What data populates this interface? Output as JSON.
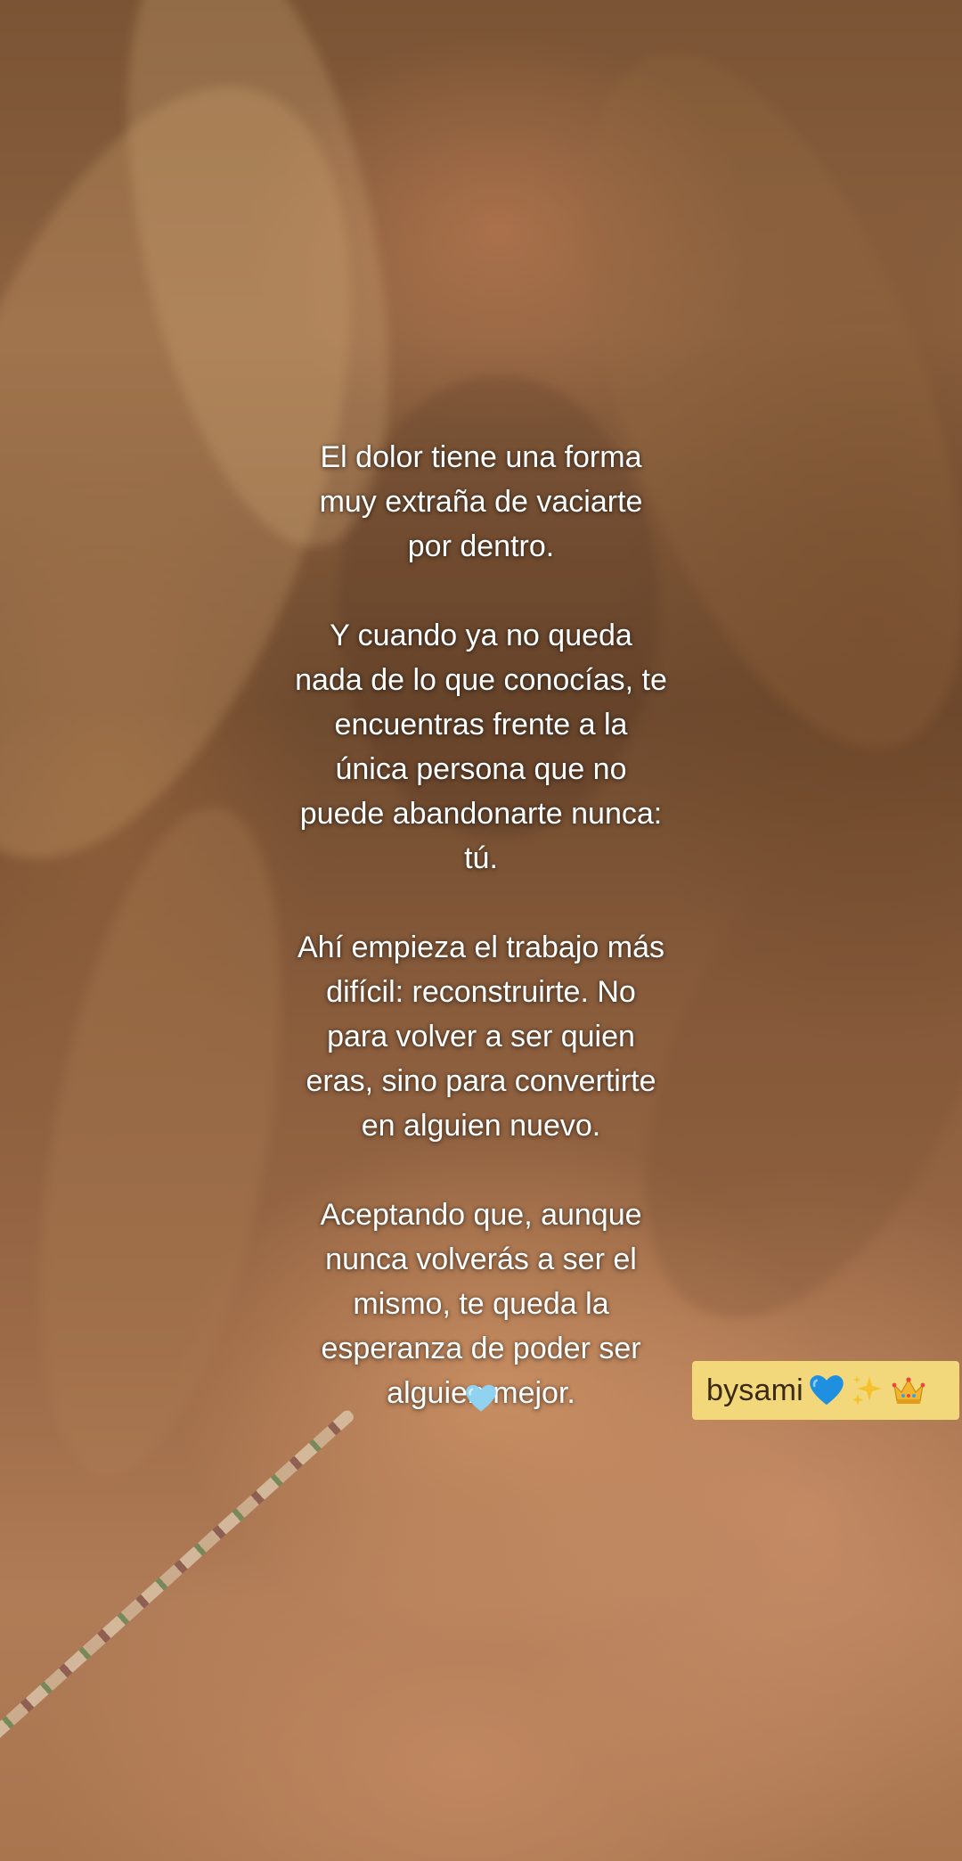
{
  "caption": {
    "text": "El dolor tiene una forma\nmuy extraña de vaciarte\npor dentro.\n\nY cuando ya no queda\nnada de lo que conocías, te\nencuentras frente a la\núnica persona que no\npuede abandonarte nunca:\ntú.\n\nAhí empieza el trabajo más\ndifícil: reconstruirte. No\npara volver a ser quien\neras, sino para convertirte\nen alguien nuevo.\n\nAceptando que, aunque\nnunca volverás a ser el\nmismo, te queda la\nesperanza de poder ser\nalguien mejor."
  },
  "caption_icon": "light-blue-heart-icon",
  "tag": {
    "label": "bysami",
    "icons": [
      "blue-heart-icon",
      "sparkles-icon",
      "crown-icon"
    ],
    "background": "#f3d77b"
  },
  "colors": {
    "caption_text": "#ffffff",
    "light_heart": "#8fd3f0",
    "blue_heart": "#1f8fe0",
    "sparkles": "#f6c12d",
    "crown": "#f2b530"
  }
}
